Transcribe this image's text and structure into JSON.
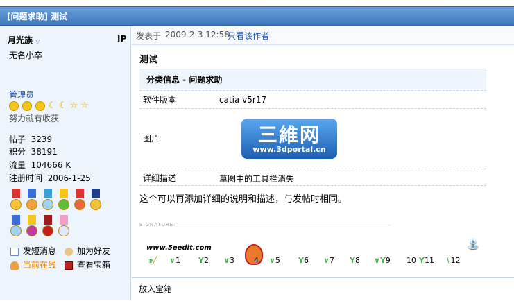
{
  "thread": {
    "title": "[问题求助] 测试"
  },
  "author": {
    "name": "月光族",
    "ip_label": "IP",
    "title": "无名小卒",
    "group": "管理员",
    "motto": "努力就有收获",
    "stats": [
      {
        "label": "帖子",
        "value": "3239"
      },
      {
        "label": "积分",
        "value": "38191"
      },
      {
        "label": "流量",
        "value": "104666 K"
      },
      {
        "label": "注册时间",
        "value": "2006-1-25"
      }
    ],
    "actions": {
      "send_message": "发短消息",
      "add_friend": "加为好友",
      "online": "当前在线",
      "treasure": "查看宝箱"
    },
    "rank_icon_colors": [
      "#f5c518",
      "#f5c518",
      "#f5c518",
      "#f5c518",
      "#f5c518",
      "#f5c518",
      "#f5c518"
    ]
  },
  "post": {
    "posted_label": "发表于",
    "datetime": "2009-2-3 12:58",
    "only_author_link": "只看该作者",
    "subject": "测试",
    "category": "分类信息  - 问题求助",
    "fields": [
      {
        "label": "软件版本",
        "value": "catia v5r17"
      },
      {
        "label": "图片",
        "value": ""
      },
      {
        "label": "详细描述",
        "value": "草图中的工具栏消失"
      }
    ],
    "image_logo": {
      "big": "三維网",
      "small": "www.3dportal.cn"
    },
    "body": "这个可以再添加详细的说明和描述，与发帖时相同。",
    "signature_label": "SIGNATURE:",
    "signature_site": "www.5eedit.com",
    "signature_levels": [
      "1",
      "2",
      "3",
      "4",
      "5",
      "6",
      "7",
      "8",
      "9",
      "10",
      "11",
      "12"
    ],
    "footer_action": "放入宝箱"
  }
}
